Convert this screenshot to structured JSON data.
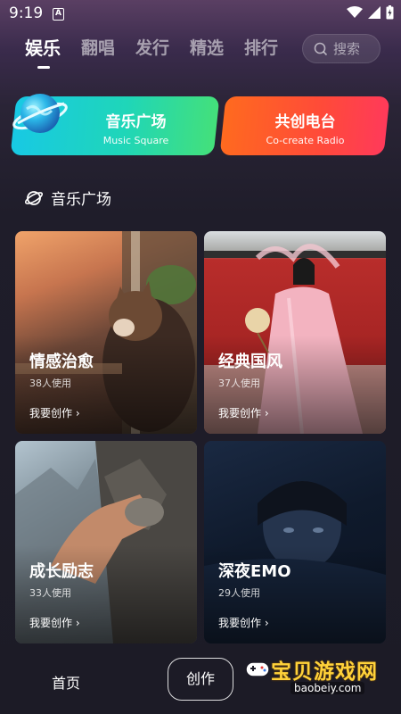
{
  "status_bar": {
    "time": "9:19",
    "notif_letter": "A"
  },
  "top_tabs": [
    {
      "label": "娱乐",
      "active": true
    },
    {
      "label": "翻唱",
      "active": false
    },
    {
      "label": "发行",
      "active": false
    },
    {
      "label": "精选",
      "active": false
    },
    {
      "label": "排行",
      "active": false
    }
  ],
  "search": {
    "placeholder": "搜索"
  },
  "banners": {
    "music": {
      "title": "音乐广场",
      "subtitle": "Music Square",
      "color_from": "#18c9e4",
      "color_to": "#44e07a"
    },
    "radio": {
      "title": "共创电台",
      "subtitle": "Co-create Radio",
      "color_from": "#ff6a1f",
      "color_to": "#ff3a5a"
    }
  },
  "section": {
    "title": "音乐广场",
    "icon": "planet-icon"
  },
  "cards": [
    {
      "title": "情感治愈",
      "users": "38人使用",
      "action": "我要创作"
    },
    {
      "title": "经典国风",
      "users": "37人使用",
      "action": "我要创作"
    },
    {
      "title": "成长励志",
      "users": "33人使用",
      "action": "我要创作"
    },
    {
      "title": "深夜EMO",
      "users": "29人使用",
      "action": "我要创作"
    }
  ],
  "bottom_nav": {
    "home": "首页",
    "create": "创作"
  },
  "watermark": {
    "text": "宝贝游戏网",
    "url": "baobeiy.com"
  }
}
